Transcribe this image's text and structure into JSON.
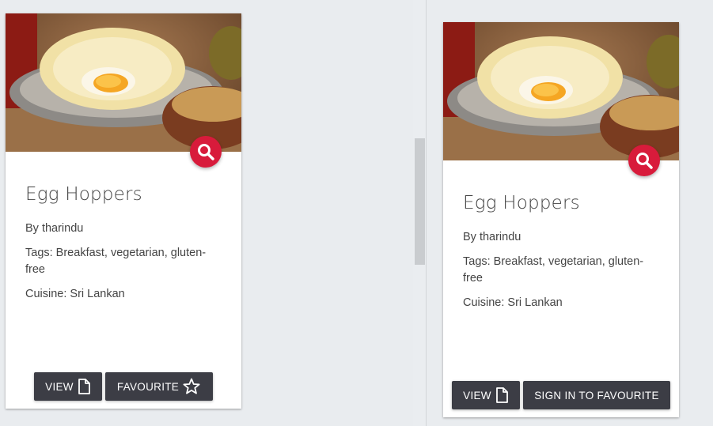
{
  "cards": [
    {
      "title": "Egg Hoppers",
      "author": "By tharindu",
      "tags": "Tags: Breakfast, vegetarian, gluten-free",
      "cuisine": "Cuisine: Sri Lankan",
      "view_label": "VIEW",
      "action_label": "FAVOURITE",
      "view_icon": "document-icon",
      "action_icon": "star-outline-icon",
      "zoom_icon": "search-icon"
    },
    {
      "title": "Egg Hoppers",
      "author": "By tharindu",
      "tags": "Tags: Breakfast, vegetarian, gluten-free",
      "cuisine": "Cuisine: Sri Lankan",
      "view_label": "VIEW",
      "action_label": "SIGN IN TO FAVOURITE",
      "view_icon": "document-icon",
      "zoom_icon": "search-icon"
    }
  ],
  "colors": {
    "accent": "#d81b3b",
    "button": "#3c3d45",
    "background": "#e9ecef"
  }
}
